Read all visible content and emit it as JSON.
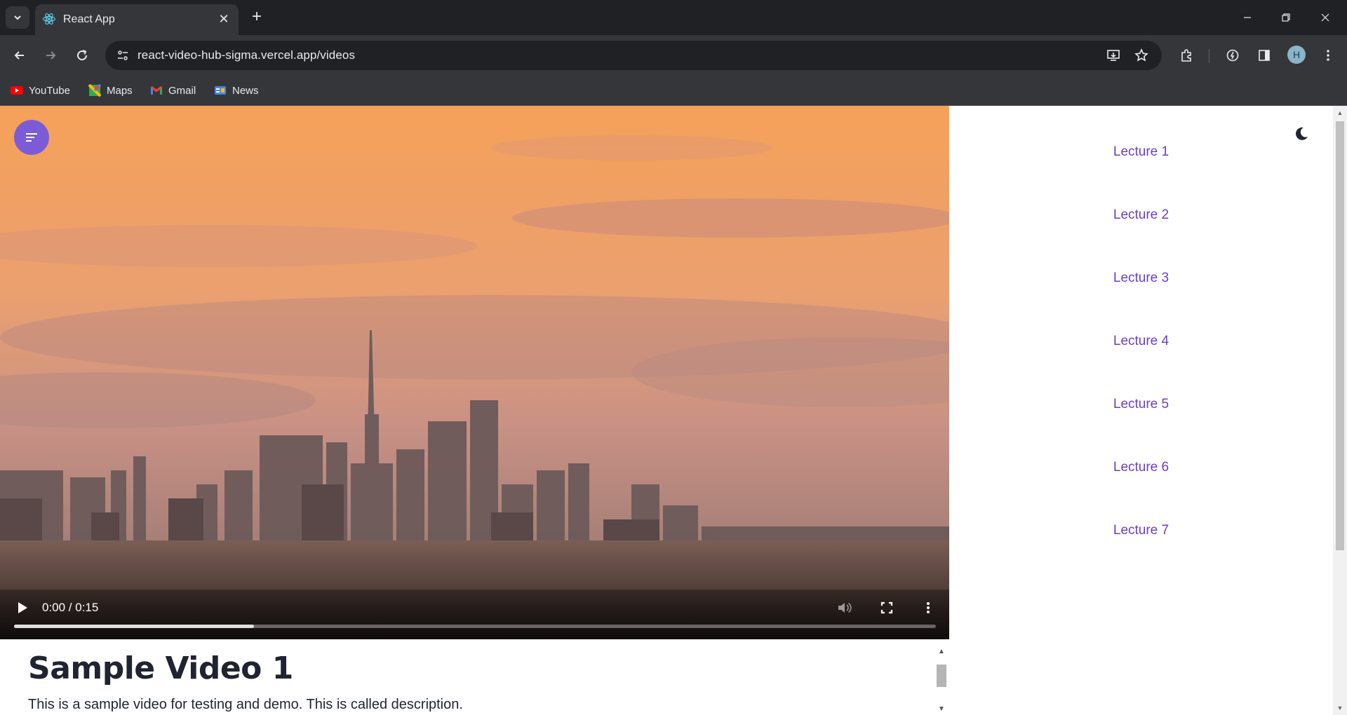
{
  "browser": {
    "tab_title": "React App",
    "url": "react-video-hub-sigma.vercel.app/videos",
    "profile_initial": "H",
    "bookmarks": [
      {
        "label": "YouTube",
        "icon": "youtube-icon"
      },
      {
        "label": "Maps",
        "icon": "maps-icon"
      },
      {
        "label": "Gmail",
        "icon": "gmail-icon"
      },
      {
        "label": "News",
        "icon": "news-icon"
      }
    ]
  },
  "player": {
    "time": "0:00 / 0:15",
    "buffered_fraction": 0.26,
    "icons": [
      "play-icon",
      "volume-icon",
      "fullscreen-icon",
      "more-vert-icon"
    ]
  },
  "video": {
    "title": "Sample Video 1",
    "description": "This is a sample video for testing and demo. This is called description."
  },
  "sidebar": {
    "lectures": [
      "Lecture 1",
      "Lecture 2",
      "Lecture 3",
      "Lecture 4",
      "Lecture 5",
      "Lecture 6",
      "Lecture 7"
    ]
  },
  "colors": {
    "accent": "#7c5cd6",
    "lecture_link": "#6a3fc4",
    "chrome_dark": "#202124",
    "chrome_toolbar": "#35363a"
  }
}
